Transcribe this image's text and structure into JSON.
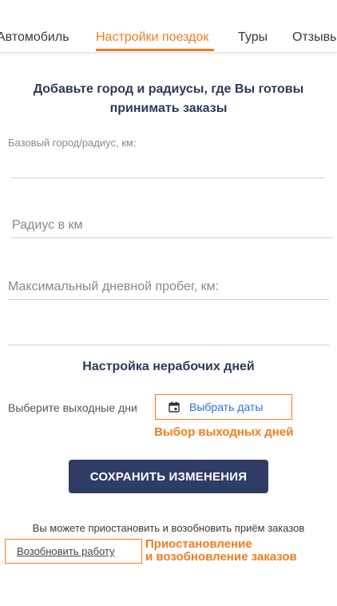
{
  "tabs": [
    {
      "label": "Автомобиль"
    },
    {
      "label": "Настройки поездок",
      "active": true
    },
    {
      "label": "Туры"
    },
    {
      "label": "Отзывы"
    }
  ],
  "section": {
    "title_line1": "Добавьте город и радиусы, где Вы готовы",
    "title_line2": "принимать заказы"
  },
  "fields": {
    "base_city_label": "Базовый город/радиус, км:",
    "base_city_value": "",
    "radius_placeholder": "Радиус в км",
    "daily_mileage_placeholder": "Максимальный дневной пробег, км:"
  },
  "days_off": {
    "title": "Настройка нерабочих дней",
    "label": "Выберите выходные дни",
    "button_label": "Выбрать даты",
    "annotation": "Выбор выходных дней"
  },
  "save_button": "СОХРАНИТЬ ИЗМЕНЕНИЯ",
  "pause": {
    "text": "Вы можете приостановить и возобновить приём заказов",
    "resume_link": "Возобновить работу",
    "annotation_line1": "Приостановление",
    "annotation_line2": "и возобновление заказов"
  },
  "colors": {
    "accent": "#f07d1e",
    "primary": "#2f3d66",
    "link": "#2f6fd1"
  }
}
